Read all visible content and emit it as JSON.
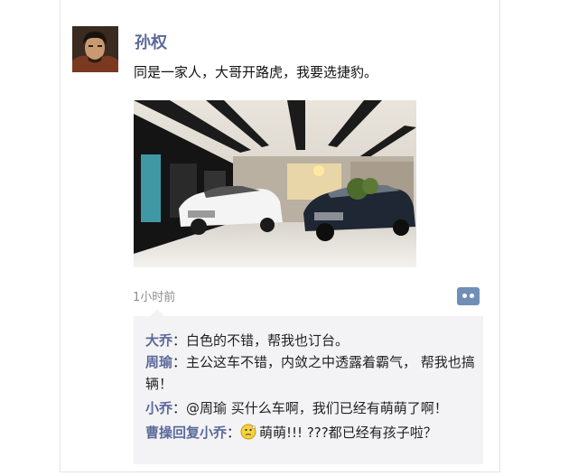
{
  "post": {
    "author": "孙权",
    "text": "同是一家人，大哥开路虎，我要选捷豹。",
    "timestamp": "1小时前"
  },
  "comments": [
    {
      "name": "大乔",
      "sep": "：",
      "text": "白色的不错，帮我也订台。"
    },
    {
      "name": "周瑜",
      "sep": "：",
      "text": "主公这车不错，内敛之中透露着霸气， 帮我也搞辆！"
    },
    {
      "name": "小乔",
      "sep": "：",
      "text": "@周瑜   买什么车啊，我们已经有萌萌了啊！"
    },
    {
      "name": "曹操回复小乔",
      "sep": "：",
      "text": "萌萌!!! ???都已经有孩子啦？"
    }
  ],
  "icons": {
    "avatar": "man-portrait-avatar",
    "photo": "jaguar-showroom-photo",
    "comment_button": "comment-bubble-icon",
    "emoji": "thinking-face-emoji"
  },
  "colors": {
    "name_blue": "#5b6a9b",
    "comment_bg": "#f3f3f5",
    "button_blue": "#6f8fb6"
  }
}
